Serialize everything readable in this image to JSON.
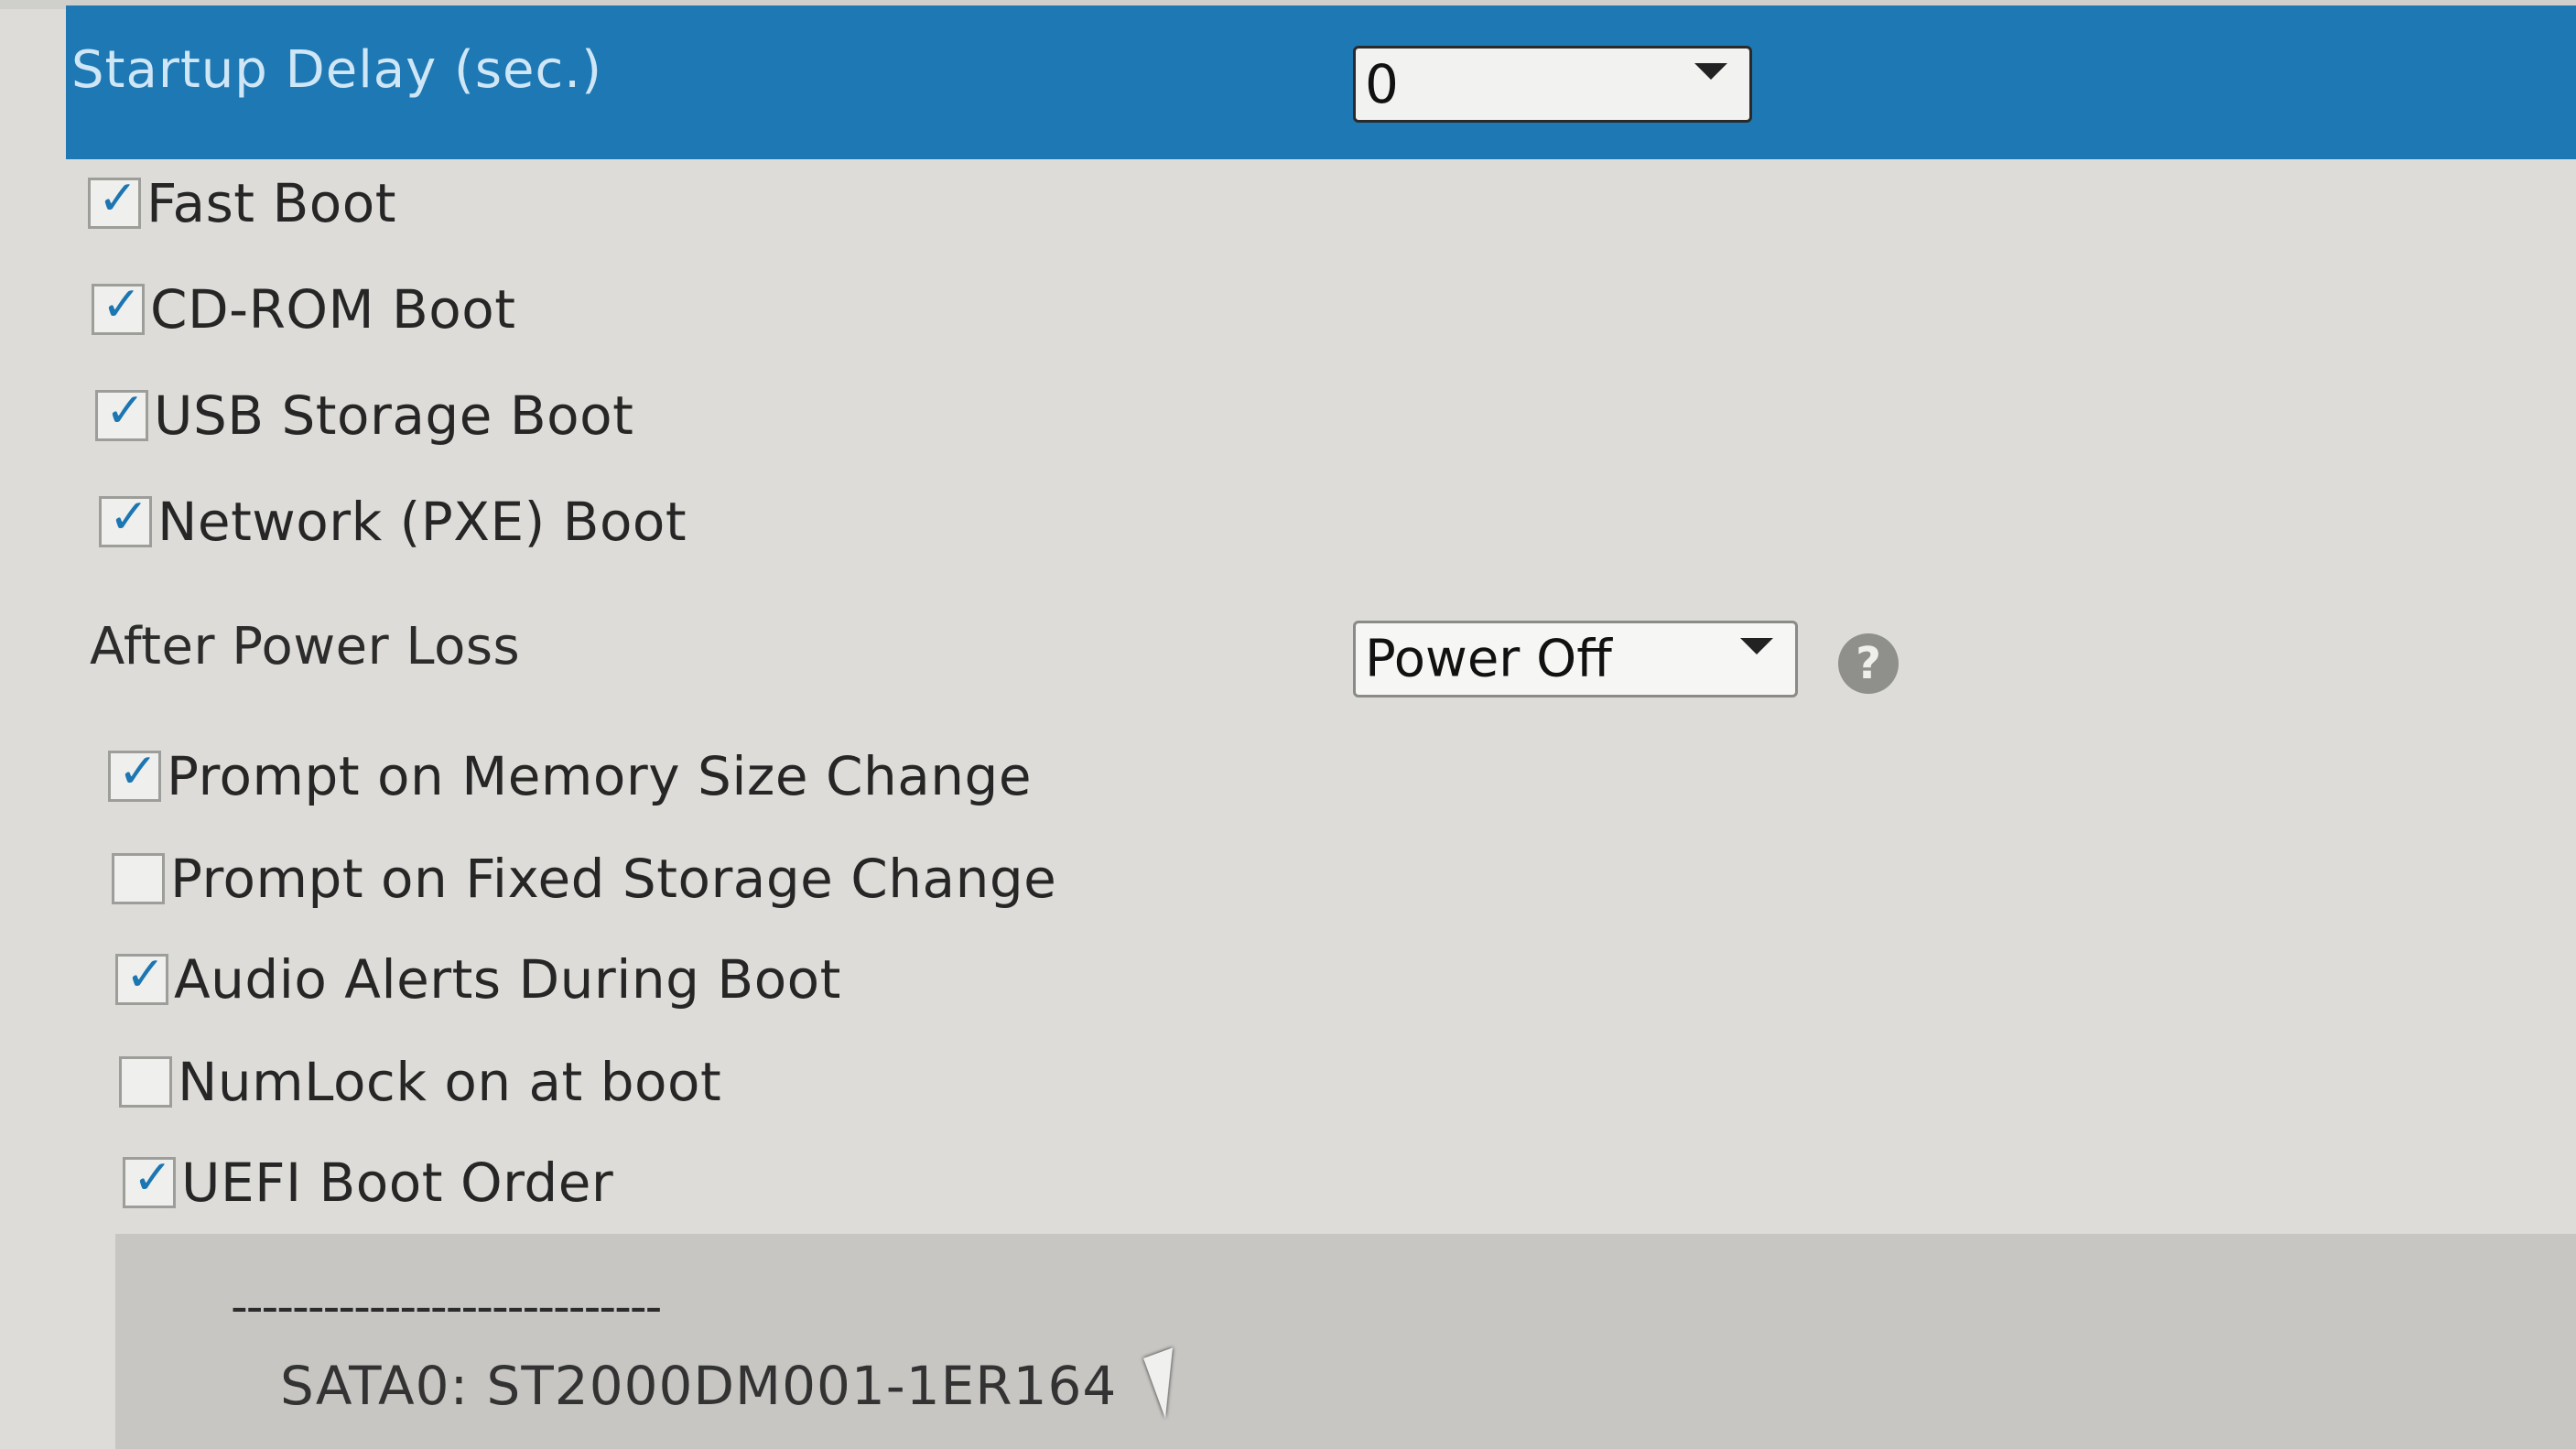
{
  "startup_delay": {
    "label": "Startup Delay (sec.)",
    "value": "0"
  },
  "boot_options": [
    {
      "label": "Fast Boot",
      "checked": true
    },
    {
      "label": "CD-ROM Boot",
      "checked": true
    },
    {
      "label": "USB Storage Boot",
      "checked": true
    },
    {
      "label": "Network (PXE) Boot",
      "checked": true
    }
  ],
  "after_power_loss": {
    "label": "After Power Loss",
    "value": "Power Off",
    "help_glyph": "?"
  },
  "other_options": [
    {
      "label": "Prompt on Memory Size Change",
      "checked": true
    },
    {
      "label": "Prompt on Fixed Storage Change",
      "checked": false
    },
    {
      "label": "Audio Alerts During Boot",
      "checked": true
    },
    {
      "label": "NumLock on at boot",
      "checked": false
    },
    {
      "label": "UEFI Boot Order",
      "checked": true
    }
  ],
  "boot_order": {
    "separator": "----------------------------",
    "device": "SATA0: ST2000DM001-1ER164"
  },
  "check_glyph": "✓",
  "colors": {
    "selected_row": "#1d78b3",
    "checkmark": "#1b76b2",
    "background": "#dddcd8"
  }
}
